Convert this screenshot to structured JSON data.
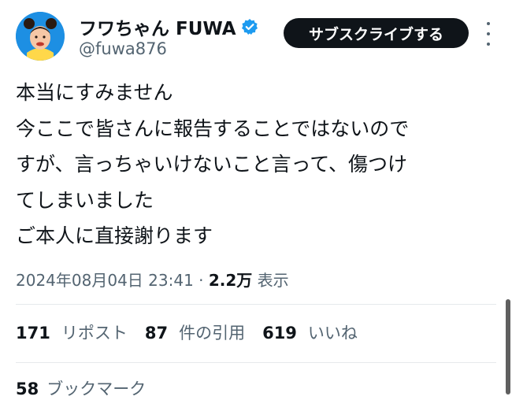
{
  "author": {
    "name": "フワちゃん FUWA",
    "handle": "@fuwa876",
    "verified": true,
    "avatar_bg": "#1d8fe3"
  },
  "subscribe_label": "サブスクライブする",
  "more_icon": "more-vertical-icon",
  "tweet": {
    "lines": [
      "本当にすみません",
      "今ここで皆さんに報告することではないので",
      "すが、言っちゃいけないこと言って、傷つけ",
      "てしまいました",
      "ご本人に直接謝ります"
    ]
  },
  "meta": {
    "timestamp": "2024年08月04日 23:41",
    "separator": "·",
    "views_count": "2.2万",
    "views_label": "表示"
  },
  "stats": {
    "reposts": {
      "count": "171",
      "label": "リポスト"
    },
    "quotes": {
      "count": "87",
      "label": "件の引用"
    },
    "likes": {
      "count": "619",
      "label": "いいね"
    },
    "bookmarks": {
      "count": "58",
      "label": "ブックマーク"
    }
  },
  "colors": {
    "text": "#0f1419",
    "muted": "#536471",
    "verified": "#1d9bf0",
    "button_bg": "#0f1419"
  }
}
